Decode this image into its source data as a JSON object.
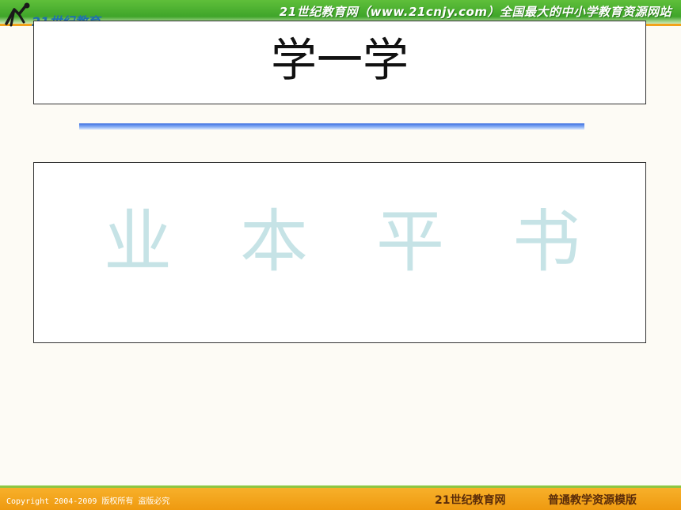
{
  "header": {
    "logo_text": "21世纪教育",
    "site_title": "21世纪教育网（www.21cnjy.com）全国最大的中小学教育资源网站"
  },
  "slide": {
    "title": "学一学",
    "characters": [
      "业",
      "本",
      "平",
      "书"
    ]
  },
  "footer": {
    "copyright": "Copyright 2004-2009 版权所有 盗版必究",
    "site_name": "21世纪教育网",
    "template_name": "普通教学资源模版"
  },
  "colors": {
    "top_band": "#3fa52a",
    "bottom_band": "#ef9a10",
    "faded_character": "#c6e3e6",
    "divider": "#3c6fe0"
  }
}
